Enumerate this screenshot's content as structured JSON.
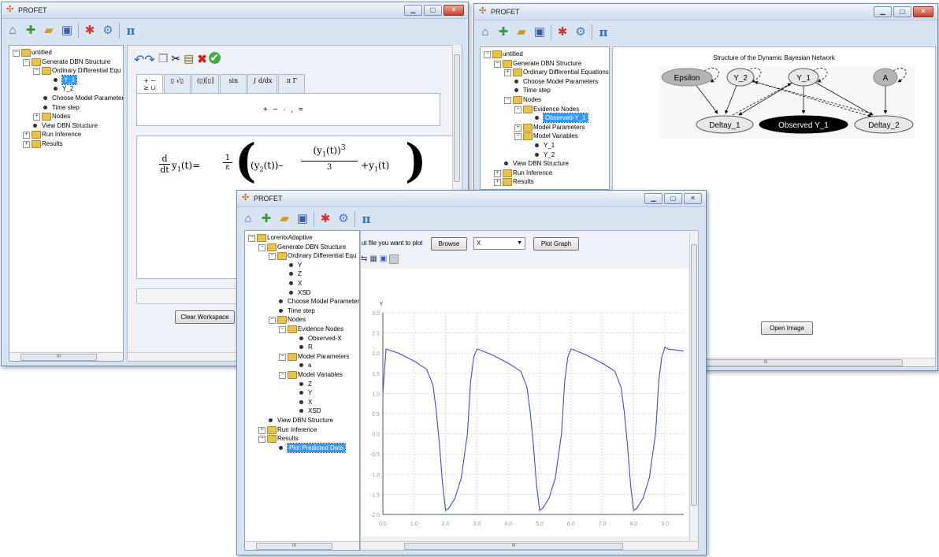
{
  "window_left": {
    "title": "PROFET",
    "toolbar_icons": [
      "home-icon",
      "add-icon",
      "open-folder-icon",
      "save-icon",
      "network-icon",
      "gear-icon",
      "pi-icon"
    ],
    "tree": [
      {
        "label": "untitled",
        "level": 0,
        "kind": "folder",
        "exp": "-"
      },
      {
        "label": "Generate DBN Structure",
        "level": 1,
        "kind": "folder",
        "exp": "-"
      },
      {
        "label": "Ordinary Differential Equ",
        "level": 2,
        "kind": "folder",
        "exp": "-"
      },
      {
        "label": "Y_1",
        "level": 3,
        "kind": "bullet",
        "selected": true
      },
      {
        "label": "Y_2",
        "level": 3,
        "kind": "bullet"
      },
      {
        "label": "Choose Model Parameter",
        "level": 2,
        "kind": "bullet"
      },
      {
        "label": "Time step",
        "level": 2,
        "kind": "bullet"
      },
      {
        "label": "Nodes",
        "level": 2,
        "kind": "folder",
        "exp": "+"
      },
      {
        "label": "View DBN Structure",
        "level": 1,
        "kind": "bullet"
      },
      {
        "label": "Run Inference",
        "level": 1,
        "kind": "folder",
        "exp": "+"
      },
      {
        "label": "Results",
        "level": 1,
        "kind": "folder",
        "exp": "+"
      }
    ],
    "palette_tabs": [
      "+ −\n≥ ∪",
      "▯ √▯",
      "(▯)[▯]",
      "sin",
      "∫ d/dx",
      "π Γ"
    ],
    "palette_symbols": "+ − · , =",
    "equation": {
      "lhs_d": "d",
      "lhs_dt": "dt",
      "lhs_var": "y",
      "lhs_sub": "1",
      "arg": "(t)",
      "eq": "=",
      "frac_num": "1",
      "frac_den": "ε",
      "y2": "y",
      "y2_sub": "2",
      "y1": "y",
      "y1_sub": "1",
      "pow": "3",
      "den": "3",
      "plus": "+"
    },
    "clear_button": "Clear Workspace",
    "scroll_glyph": "III"
  },
  "window_right": {
    "title": "PROFET",
    "toolbar_icons": [
      "home-icon",
      "add-icon",
      "open-folder-icon",
      "save-icon",
      "network-icon",
      "gear-icon",
      "pi-icon"
    ],
    "tree": [
      {
        "label": "untitled",
        "level": 0,
        "kind": "folder",
        "exp": "-"
      },
      {
        "label": "Generate DBN Structure",
        "level": 1,
        "kind": "folder",
        "exp": "-"
      },
      {
        "label": "Ordinary Differential Equations",
        "level": 2,
        "kind": "folder",
        "exp": "+"
      },
      {
        "label": "Choose Model Parameters",
        "level": 2,
        "kind": "bullet"
      },
      {
        "label": "Time step",
        "level": 2,
        "kind": "bullet"
      },
      {
        "label": "Nodes",
        "level": 2,
        "kind": "folder",
        "exp": "-"
      },
      {
        "label": "Evidence Nodes",
        "level": 3,
        "kind": "folder",
        "exp": "-"
      },
      {
        "label": "Observed-Y_1",
        "level": 4,
        "kind": "bullet",
        "selected": true
      },
      {
        "label": "Model Parameters",
        "level": 3,
        "kind": "folder",
        "exp": "+"
      },
      {
        "label": "Model Variables",
        "level": 3,
        "kind": "folder",
        "exp": "-"
      },
      {
        "label": "Y_1",
        "level": 4,
        "kind": "bullet"
      },
      {
        "label": "Y_2",
        "level": 4,
        "kind": "bullet"
      },
      {
        "label": "View DBN Structure",
        "level": 1,
        "kind": "bullet"
      },
      {
        "label": "Run Inference",
        "level": 1,
        "kind": "folder",
        "exp": "+"
      },
      {
        "label": "Results",
        "level": 1,
        "kind": "folder",
        "exp": "+"
      }
    ],
    "dbn_title": "Structure of the Dynamic Bayesian Network",
    "nodes": {
      "epsilon": "Epsilon",
      "y2": "Y_2",
      "y1": "Y_1",
      "a": "A",
      "deltay1": "Deltay_1",
      "obs": "Observed Y_1",
      "deltay2": "Deltay_2"
    },
    "open_button": "Open Image",
    "scroll_glyph": "III"
  },
  "window_front": {
    "title": "PROFET",
    "toolbar_icons": [
      "home-icon",
      "add-icon",
      "open-folder-icon",
      "save-icon",
      "network-icon",
      "gear-icon",
      "pi-icon"
    ],
    "tree": [
      {
        "label": "LorentxAdaptive",
        "level": 0,
        "kind": "folder",
        "exp": "-"
      },
      {
        "label": "Generate DBN Structure",
        "level": 1,
        "kind": "folder",
        "exp": "-"
      },
      {
        "label": "Ordinary Differential Equ",
        "level": 2,
        "kind": "folder",
        "exp": "-"
      },
      {
        "label": "Y",
        "level": 3,
        "kind": "bullet"
      },
      {
        "label": "Z",
        "level": 3,
        "kind": "bullet"
      },
      {
        "label": "X",
        "level": 3,
        "kind": "bullet"
      },
      {
        "label": "XSD",
        "level": 3,
        "kind": "bullet"
      },
      {
        "label": "Choose Model Parameter",
        "level": 2,
        "kind": "bullet"
      },
      {
        "label": "Time step",
        "level": 2,
        "kind": "bullet"
      },
      {
        "label": "Nodes",
        "level": 2,
        "kind": "folder",
        "exp": "-"
      },
      {
        "label": "Evidence Nodes",
        "level": 3,
        "kind": "folder",
        "exp": "-"
      },
      {
        "label": "Observed-X",
        "level": 4,
        "kind": "bullet"
      },
      {
        "label": "R",
        "level": 4,
        "kind": "bullet"
      },
      {
        "label": "Model Parameters",
        "level": 3,
        "kind": "folder",
        "exp": "-"
      },
      {
        "label": "a",
        "level": 4,
        "kind": "bullet"
      },
      {
        "label": "Model Variables",
        "level": 3,
        "kind": "folder",
        "exp": "-"
      },
      {
        "label": "Z",
        "level": 4,
        "kind": "bullet"
      },
      {
        "label": "Y",
        "level": 4,
        "kind": "bullet"
      },
      {
        "label": "X",
        "level": 4,
        "kind": "bullet"
      },
      {
        "label": "XSD",
        "level": 4,
        "kind": "bullet"
      },
      {
        "label": "View DBN Structure",
        "level": 1,
        "kind": "bullet"
      },
      {
        "label": "Run Inference",
        "level": 1,
        "kind": "folder",
        "exp": "+"
      },
      {
        "label": "Results",
        "level": 1,
        "kind": "folder",
        "exp": "-"
      },
      {
        "label": "Plot Predicted Data",
        "level": 2,
        "kind": "bullet",
        "selected": true
      }
    ],
    "prompt_text": "ut file you want to plot",
    "browse_button": "Browse",
    "select_value": "X",
    "plot_button": "Plot Graph",
    "scroll_glyph": "III"
  },
  "chart_data": {
    "type": "line",
    "ylabel": "Y",
    "xlabel": "",
    "xlim": [
      0,
      9.6
    ],
    "ylim": [
      -2.0,
      3.0
    ],
    "xticks": [
      "0.0",
      "1.0",
      "2.0",
      "3.0",
      "4.0",
      "5.0",
      "6.0",
      "7.0",
      "8.0",
      "9.0"
    ],
    "yticks": [
      "3.0",
      "2.5",
      "2.0",
      "1.5",
      "1.0",
      "0.5",
      "0.0",
      "-0.5",
      "-1.0",
      "-1.5",
      "-2.0"
    ],
    "grid": true,
    "series": [
      {
        "color": "#3a4fd0",
        "x": [
          0.0,
          0.1,
          0.5,
          1.0,
          1.4,
          1.6,
          1.7,
          1.8,
          1.9,
          2.0,
          2.1,
          2.3,
          2.5,
          2.7,
          2.8,
          2.9,
          3.0,
          3.1,
          3.5,
          4.0,
          4.4,
          4.6,
          4.7,
          4.8,
          4.9,
          5.0,
          5.1,
          5.3,
          5.5,
          5.7,
          5.8,
          5.9,
          6.0,
          6.1,
          6.5,
          7.0,
          7.4,
          7.6,
          7.7,
          7.8,
          7.9,
          8.0,
          8.1,
          8.3,
          8.5,
          8.7,
          8.8,
          8.9,
          9.0,
          9.1,
          9.6
        ],
        "y": [
          1.0,
          2.1,
          2.0,
          1.8,
          1.6,
          1.2,
          0.6,
          -0.2,
          -1.2,
          -1.9,
          -1.85,
          -1.6,
          -1.1,
          0.0,
          1.3,
          1.9,
          2.1,
          2.08,
          1.95,
          1.75,
          1.55,
          1.15,
          0.55,
          -0.25,
          -1.25,
          -1.9,
          -1.85,
          -1.6,
          -1.1,
          0.0,
          1.3,
          1.9,
          2.1,
          2.08,
          1.95,
          1.75,
          1.55,
          1.15,
          0.55,
          -0.25,
          -1.25,
          -1.9,
          -1.85,
          -1.6,
          -1.1,
          0.0,
          1.3,
          1.9,
          2.15,
          2.1,
          2.05
        ]
      }
    ]
  }
}
